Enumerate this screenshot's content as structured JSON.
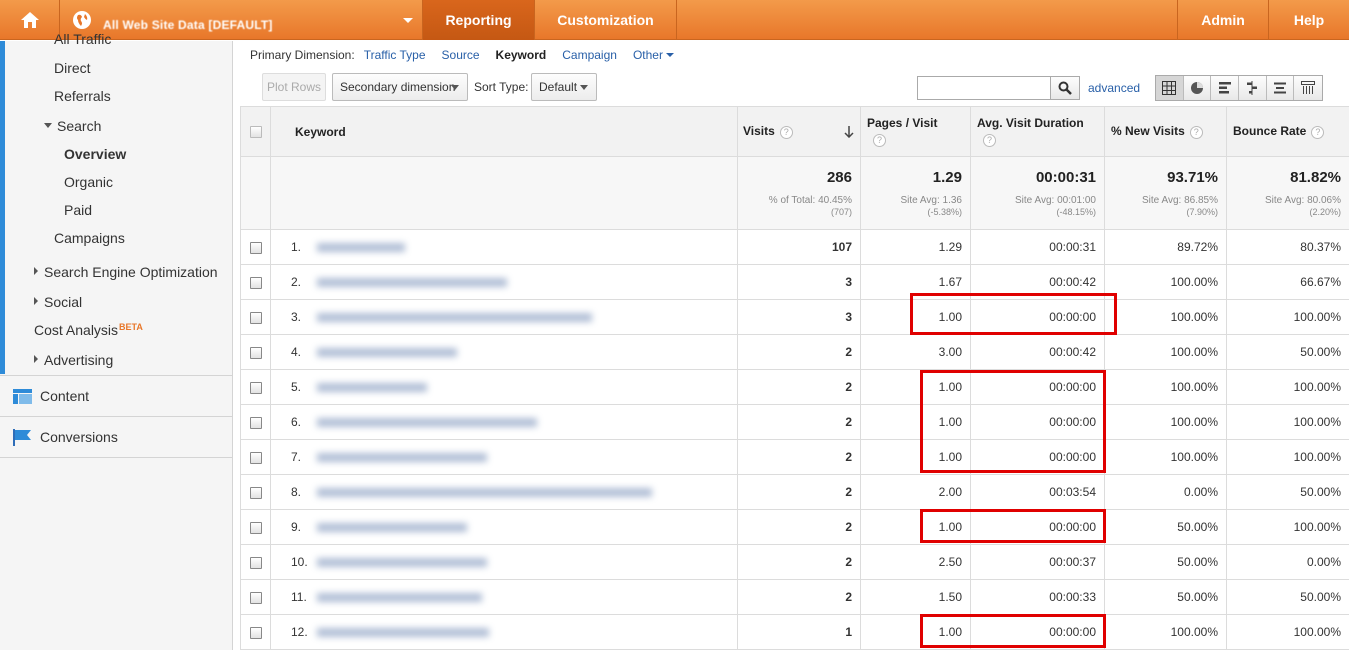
{
  "topbar": {
    "account_name": "All Web Site Data [DEFAULT]",
    "tabs": {
      "reporting": "Reporting",
      "customization": "Customization",
      "admin": "Admin",
      "help": "Help"
    }
  },
  "sidebar": {
    "all_traffic": "All Traffic",
    "direct": "Direct",
    "referrals": "Referrals",
    "search": "Search",
    "overview": "Overview",
    "organic": "Organic",
    "paid": "Paid",
    "campaigns": "Campaigns",
    "seo": "Search Engine Optimization",
    "social": "Social",
    "cost_analysis": "Cost Analysis",
    "beta": "BETA",
    "advertising": "Advertising",
    "content": "Content",
    "conversions": "Conversions"
  },
  "dimensions": {
    "label": "Primary Dimension:",
    "traffic_type": "Traffic Type",
    "source": "Source",
    "keyword": "Keyword",
    "campaign": "Campaign",
    "other": "Other"
  },
  "toolbar": {
    "plot_rows": "Plot Rows",
    "secondary_dimension": "Secondary dimension",
    "sort_type_label": "Sort Type:",
    "sort_type_value": "Default",
    "search_value": "",
    "advanced": "advanced"
  },
  "table": {
    "headers": {
      "keyword": "Keyword",
      "visits": "Visits",
      "pages_visit": "Pages / Visit",
      "avg_duration": "Avg. Visit Duration",
      "new_visits": "% New Visits",
      "bounce_rate": "Bounce Rate"
    },
    "totals": {
      "visits": "286",
      "visits_sub": "% of Total: 40.45%",
      "visits_tiny": "(707)",
      "pages": "1.29",
      "pages_sub": "Site Avg: 1.36",
      "pages_tiny": "(-5.38%)",
      "duration": "00:00:31",
      "duration_sub": "Site Avg: 00:01:00",
      "duration_tiny": "(-48.15%)",
      "new_visits": "93.71%",
      "new_visits_sub": "Site Avg: 86.85%",
      "new_visits_tiny": "(7.90%)",
      "bounce": "81.82%",
      "bounce_sub": "Site Avg: 80.06%",
      "bounce_tiny": "(2.20%)"
    },
    "rows": [
      {
        "n": "1.",
        "visits": "107",
        "pages": "1.29",
        "duration": "00:00:31",
        "new": "89.72%",
        "bounce": "80.37%"
      },
      {
        "n": "2.",
        "visits": "3",
        "pages": "1.67",
        "duration": "00:00:42",
        "new": "100.00%",
        "bounce": "66.67%"
      },
      {
        "n": "3.",
        "visits": "3",
        "pages": "1.00",
        "duration": "00:00:00",
        "new": "100.00%",
        "bounce": "100.00%"
      },
      {
        "n": "4.",
        "visits": "2",
        "pages": "3.00",
        "duration": "00:00:42",
        "new": "100.00%",
        "bounce": "50.00%"
      },
      {
        "n": "5.",
        "visits": "2",
        "pages": "1.00",
        "duration": "00:00:00",
        "new": "100.00%",
        "bounce": "100.00%"
      },
      {
        "n": "6.",
        "visits": "2",
        "pages": "1.00",
        "duration": "00:00:00",
        "new": "100.00%",
        "bounce": "100.00%"
      },
      {
        "n": "7.",
        "visits": "2",
        "pages": "1.00",
        "duration": "00:00:00",
        "new": "100.00%",
        "bounce": "100.00%"
      },
      {
        "n": "8.",
        "visits": "2",
        "pages": "2.00",
        "duration": "00:03:54",
        "new": "0.00%",
        "bounce": "50.00%"
      },
      {
        "n": "9.",
        "visits": "2",
        "pages": "1.00",
        "duration": "00:00:00",
        "new": "50.00%",
        "bounce": "100.00%"
      },
      {
        "n": "10.",
        "visits": "2",
        "pages": "2.50",
        "duration": "00:00:37",
        "new": "50.00%",
        "bounce": "0.00%"
      },
      {
        "n": "11.",
        "visits": "2",
        "pages": "1.50",
        "duration": "00:00:33",
        "new": "50.00%",
        "bounce": "50.00%"
      },
      {
        "n": "12.",
        "visits": "1",
        "pages": "1.00",
        "duration": "00:00:00",
        "new": "100.00%",
        "bounce": "100.00%"
      }
    ]
  },
  "colors": {
    "brand_orange": "#e8772a",
    "active_tab": "#c55813",
    "link_blue": "#2960a8",
    "highlight_red": "#e00000"
  }
}
